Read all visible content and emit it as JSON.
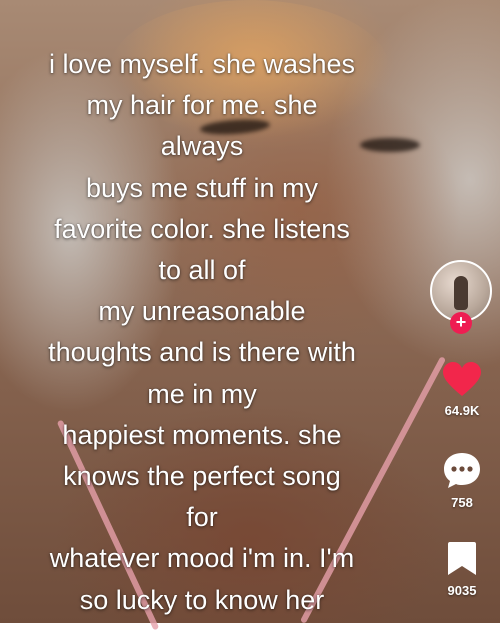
{
  "caption": {
    "lines": [
      "i love myself. she washes",
      "my hair for me. she",
      "always",
      "buys me stuff in my",
      "favorite color. she listens",
      "to all of",
      "my unreasonable",
      "thoughts and is there with",
      "me in my",
      "happiest moments. she",
      "knows the perfect song",
      "for",
      "whatever mood i'm in. I'm",
      "so lucky to know her"
    ]
  },
  "sidebar": {
    "follow_symbol": "+",
    "like_count": "64.9K",
    "comment_count": "758",
    "bookmark_count": "9035"
  },
  "colors": {
    "like": "#f2264b",
    "follow": "#ee1d52",
    "text": "#ffffff"
  }
}
